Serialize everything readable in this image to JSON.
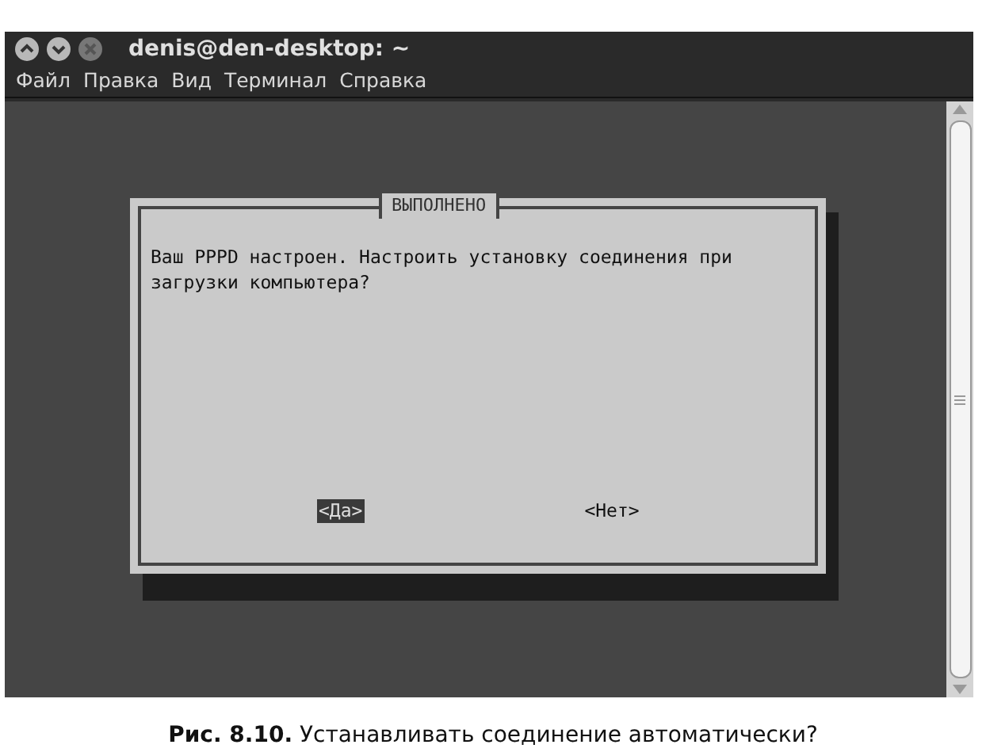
{
  "window": {
    "title": "denis@den-desktop: ~"
  },
  "menu": [
    "Файл",
    "Правка",
    "Вид",
    "Терминал",
    "Справка"
  ],
  "dialog": {
    "title": "ВЫПОЛНЕНО",
    "message": "Ваш PPPD настроен. Настроить установку соединения при загрузки компьютера?",
    "buttons": [
      {
        "label": "<Да>",
        "selected": true
      },
      {
        "label": "<Нет>",
        "selected": false
      }
    ]
  },
  "caption": "**Рис. 8.10.** Устанавливать соединение автоматически?"
}
